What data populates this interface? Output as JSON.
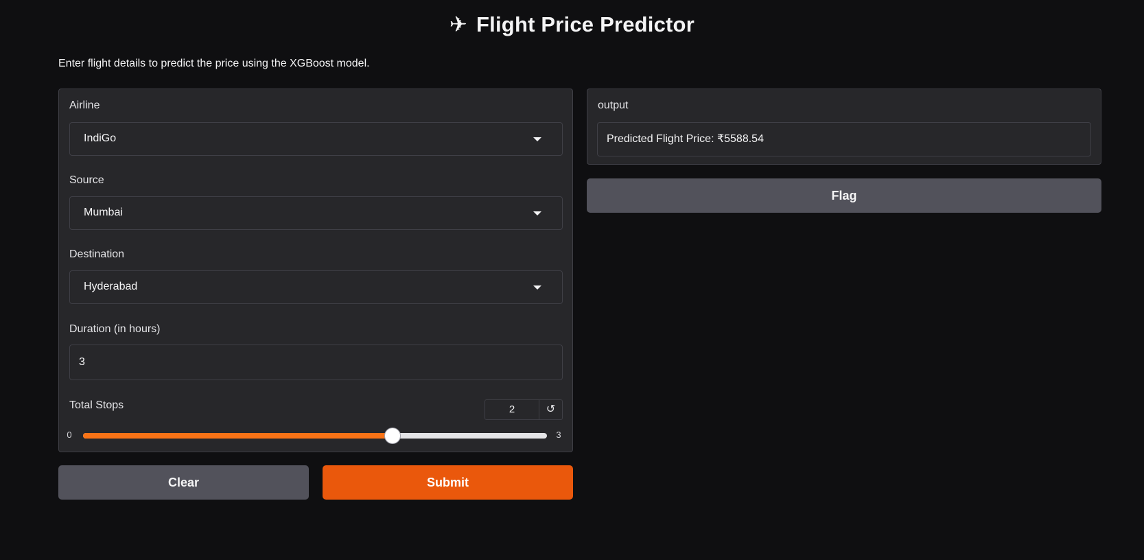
{
  "header": {
    "icon": "airplane-icon",
    "icon_glyph": "✈",
    "title": "Flight Price Predictor",
    "description": "Enter flight details to predict the price using the XGBoost model."
  },
  "form": {
    "airline": {
      "label": "Airline",
      "value": "IndiGo"
    },
    "source": {
      "label": "Source",
      "value": "Mumbai"
    },
    "destination": {
      "label": "Destination",
      "value": "Hyderabad"
    },
    "duration": {
      "label": "Duration (in hours)",
      "value": "3"
    },
    "stops": {
      "label": "Total Stops",
      "value": "2",
      "min": "0",
      "max": "3",
      "fraction": 0.6667,
      "reset_glyph": "↺"
    }
  },
  "actions": {
    "clear_label": "Clear",
    "submit_label": "Submit"
  },
  "output": {
    "label": "output",
    "value": "Predicted Flight Price: ₹5588.54",
    "flag_label": "Flag"
  },
  "colors": {
    "accent": "#ea580c",
    "slider_fill": "#f97316",
    "background": "#0f0f11",
    "panel": "#27272a",
    "secondary_button": "#52525b"
  }
}
